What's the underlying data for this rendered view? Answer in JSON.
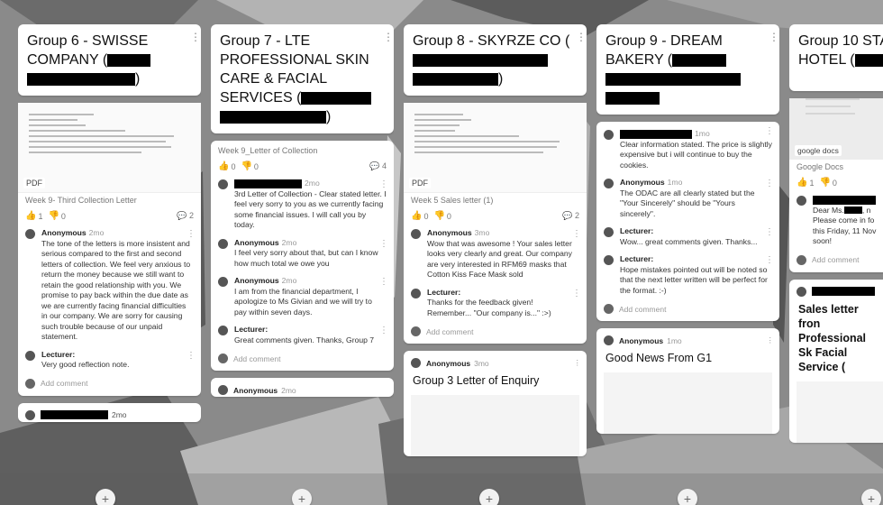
{
  "columns": [
    {
      "title_pre": "Group 6 - SWISSE COMPANY (",
      "title_post": ")",
      "attachment": {
        "badge": "PDF",
        "caption": "Week 9- Third Collection Letter"
      },
      "reactions": {
        "likes": "1",
        "dislikes": "0",
        "comments": "2"
      },
      "comments": [
        {
          "author": "Anonymous",
          "time": "2mo",
          "text": "The tone of the letters is more insistent and serious compared to the first and second letters of collection. We feel very anxious to return the money because we still want to retain the good relationship with you. We promise to pay back within the due date as we are currently facing financial difficulties in our company. We are sorry for causing such trouble because of our unpaid statement."
        },
        {
          "author": "Lecturer:",
          "time": "",
          "text": "Very good reflection note."
        }
      ],
      "add_comment": "Add comment",
      "next_time": "2mo"
    },
    {
      "title_pre": "Group 7 - LTE PROFESSIONAL SKIN CARE & FACIAL SERVICES (",
      "title_post": ")",
      "caption": "Week 9_Letter of Collection",
      "reactions": {
        "likes": "0",
        "dislikes": "0",
        "comments": "4"
      },
      "post_time": "2mo",
      "post_text": "3rd Letter of Collection - Clear stated letter. I feel very sorry to you as we currently facing some financial issues. I will call you by today.",
      "comments": [
        {
          "author": "Anonymous",
          "time": "2mo",
          "text": "I feel very sorry about that, but can I know how much total we owe you"
        },
        {
          "author": "Anonymous",
          "time": "2mo",
          "text": "I am from the financial department,  I apologize to Ms Givian and we will try to pay within seven days."
        },
        {
          "author": "Lecturer:",
          "time": "",
          "text": "Great comments given. Thanks, Group 7"
        }
      ],
      "add_comment": "Add comment",
      "next_author": "Anonymous",
      "next_time": "2mo"
    },
    {
      "title_pre": "Group 8 - SKYRZE CO (",
      "title_post": ")",
      "attachment": {
        "badge": "PDF",
        "caption": "Week 5 Sales letter (1)"
      },
      "reactions": {
        "likes": "0",
        "dislikes": "0",
        "comments": "2"
      },
      "comments": [
        {
          "author": "Anonymous",
          "time": "3mo",
          "text": "Wow that was awesome ! Your sales letter looks very clearly and great. Our company are very interested in RFM69 masks that Cotton Kiss Face Mask sold"
        },
        {
          "author": "Lecturer:",
          "time": "",
          "text": "Thanks for the feedback given! Remember... \"Our company is...\" :>)"
        }
      ],
      "add_comment": "Add comment",
      "next_post": {
        "author": "Anonymous",
        "time": "3mo",
        "title": "Group 3 Letter of Enquiry"
      }
    },
    {
      "title_pre": "Group 9 - DREAM BAKERY (",
      "title_post": "",
      "post_time": "1mo",
      "post_text": "Clear information stated. The price is slightly expensive but i will continue to buy the cookies.",
      "comments": [
        {
          "author": "Anonymous",
          "time": "1mo",
          "text": "The ODAC are all clearly stated but the \"Your Sincerely\" should be \"Yours sincerely\"."
        },
        {
          "author": "Lecturer:",
          "time": "",
          "text": "Wow... great comments given. Thanks..."
        },
        {
          "author": "Lecturer:",
          "time": "",
          "text": "Hope mistakes pointed out will be noted so that the next letter written will be perfect for the format. :-)"
        }
      ],
      "add_comment": "Add comment",
      "next_post": {
        "author": "Anonymous",
        "time": "1mo",
        "title": "Good News From G1"
      }
    },
    {
      "title_pre": "Group 10 STA",
      "title_line2": "HOTEL (",
      "attachment_label": "google docs",
      "caption": "Google Docs",
      "reactions": {
        "likes": "1",
        "dislikes": "0"
      },
      "post_text_1": "Dear Ms.",
      "post_text_1b": ", n",
      "post_text_2": "Please come in fo",
      "post_text_3": "this Friday, 11 Nov",
      "post_text_4": "soon!",
      "add_comment": "Add comment",
      "next_post_title": "Sales letter fron Professional Sk Facial Service ("
    }
  ],
  "add_button": "+"
}
